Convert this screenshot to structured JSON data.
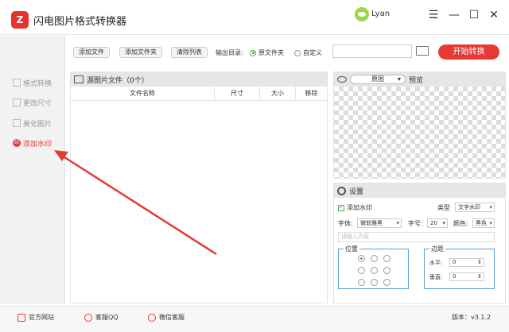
{
  "app": {
    "title": "闪电图片格式转换器",
    "logo_text": "Z",
    "user_name": "Lyan"
  },
  "window": {
    "menu_icon": "☰",
    "minimize_icon": "—",
    "maximize_icon": "☐",
    "close_icon": "✕"
  },
  "sidebar": {
    "items": [
      {
        "label": "格式转换",
        "active": false
      },
      {
        "label": "更改尺寸",
        "active": false
      },
      {
        "label": "美化图片",
        "active": false
      },
      {
        "label": "添加水印",
        "active": true
      }
    ]
  },
  "toolbar": {
    "add_file": "添加文件",
    "add_folder": "添加文件夹",
    "clear_list": "清除列表",
    "output_label": "输出目录:",
    "radio_original": "原文件夹",
    "radio_custom": "自定义",
    "start_button": "开始转换"
  },
  "file_panel": {
    "header": "源图片文件（0个）",
    "columns": [
      "文件名称",
      "尺寸",
      "大小",
      "移除"
    ]
  },
  "preview": {
    "select_value": "原图",
    "label": "预览"
  },
  "settings": {
    "header": "设置",
    "add_watermark": "添加水印",
    "type_label": "类型",
    "type_value": "文字水印",
    "font_label": "字体:",
    "font_value": "微软雅黑",
    "size_label": "字号:",
    "size_value": "20",
    "color_label": "颜色:",
    "color_value": "黑色",
    "text_placeholder": "请输入内容",
    "position_label": "位置",
    "margin_label": "边距",
    "horizontal_label": "水平:",
    "horizontal_value": "0",
    "vertical_label": "垂直:",
    "vertical_value": "0"
  },
  "footer": {
    "website": "官方网站",
    "qq": "客服QQ",
    "wechat": "微信客服",
    "version": "版本：v3.1.2"
  },
  "colors": {
    "accent": "#e53935",
    "green": "#4caf50",
    "frame": "#5aa0e0"
  }
}
